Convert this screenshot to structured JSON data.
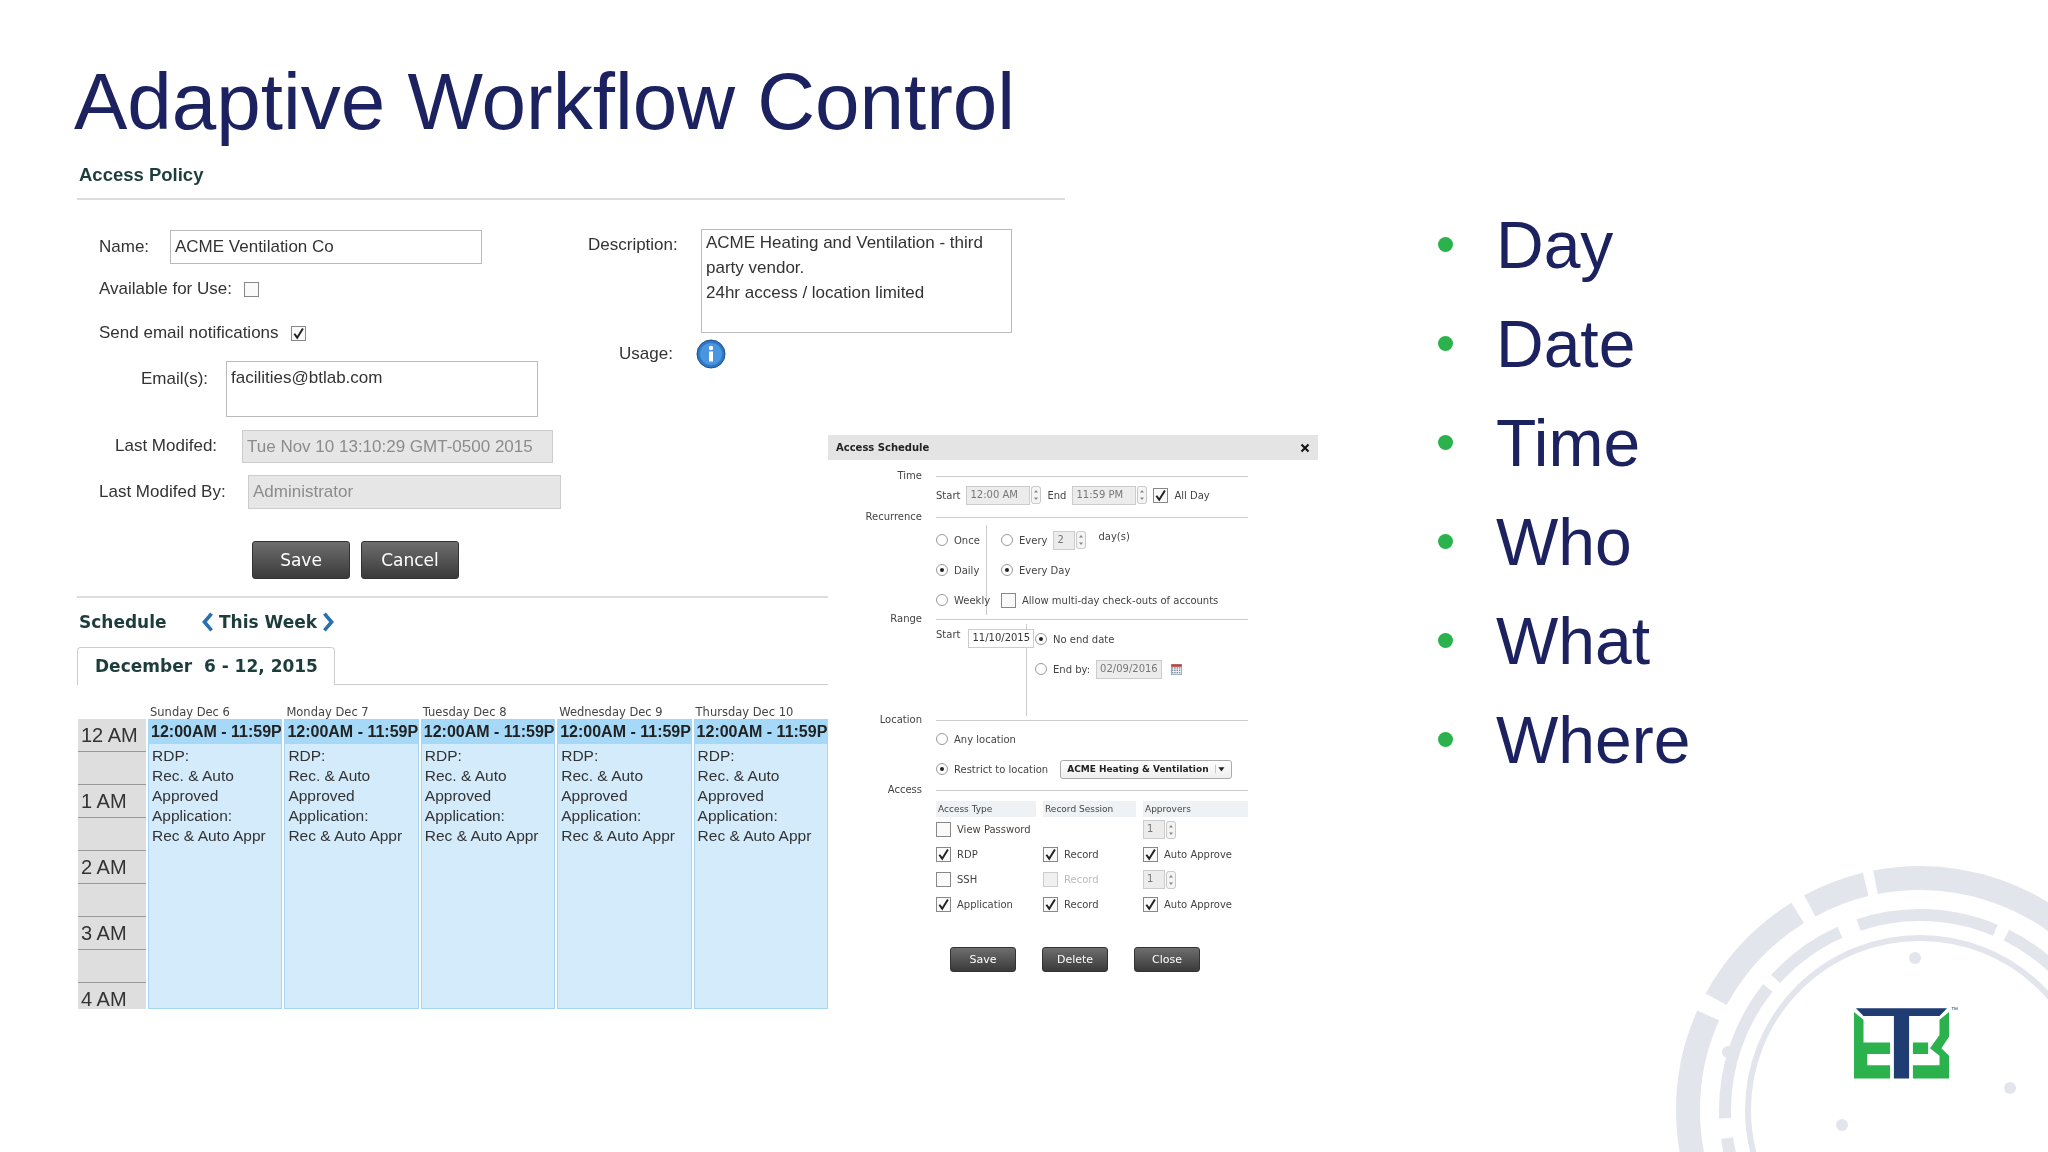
{
  "slide": {
    "title": "Adaptive Workflow Control",
    "bullets": [
      "Day",
      "Date",
      "Time",
      "Who",
      "What",
      "Where"
    ],
    "logo_mark": "™"
  },
  "access_policy": {
    "heading": "Access Policy",
    "name": {
      "label": "Name:",
      "value": "ACME Ventilation Co"
    },
    "available": {
      "label": "Available for Use:",
      "checked": false
    },
    "notifications": {
      "label": "Send email notifications",
      "checked": true
    },
    "emails": {
      "label": "Email(s):",
      "value": "facilities@btlab.com"
    },
    "last_modified": {
      "label": "Last Modifed:",
      "value": "Tue Nov 10 13:10:29 GMT-0500 2015",
      "disabled": true
    },
    "last_modified_by": {
      "label": "Last Modifed By:",
      "value": "Administrator",
      "disabled": true
    },
    "description": {
      "label": "Description:",
      "value": "ACME Heating and Ventilation - third party vendor.\n24hr access / location limited"
    },
    "usage": {
      "label": "Usage:"
    },
    "buttons": [
      "Save",
      "Cancel"
    ]
  },
  "schedule": {
    "heading": "Schedule",
    "nav_label": "This Week",
    "tab": "December  6 - 12, 2015",
    "hours": [
      "12 AM",
      "1 AM",
      "2 AM",
      "3 AM",
      "4 AM"
    ],
    "days": [
      {
        "header": "Sunday Dec 6",
        "event_time": "12:00AM - 11:59P",
        "event_text": "RDP:\nRec. & Auto\nApproved\nApplication:\nRec & Auto Appr"
      },
      {
        "header": "Monday Dec 7",
        "event_time": "12:00AM - 11:59P",
        "event_text": "RDP:\nRec. & Auto\nApproved\nApplication:\nRec & Auto Appr"
      },
      {
        "header": "Tuesday Dec 8",
        "event_time": "12:00AM - 11:59P",
        "event_text": "RDP:\nRec. & Auto\nApproved\nApplication:\nRec & Auto Appr"
      },
      {
        "header": "Wednesday Dec 9",
        "event_time": "12:00AM - 11:59P",
        "event_text": "RDP:\nRec. & Auto\nApproved\nApplication:\nRec & Auto Appr"
      },
      {
        "header": "Thursday Dec 10",
        "event_time": "12:00AM - 11:59P",
        "event_text": "RDP:\nRec. & Auto\nApproved\nApplication:\nRec & Auto Appr"
      }
    ]
  },
  "dialog": {
    "title": "Access Schedule",
    "time": {
      "label": "Time",
      "start_label": "Start",
      "start": "12:00 AM",
      "end_label": "End",
      "end": "11:59 PM",
      "all_day": {
        "label": "All Day",
        "checked": true
      }
    },
    "recurrence": {
      "label": "Recurrence",
      "options": [
        {
          "label": "Once",
          "selected": false
        },
        {
          "label": "Daily",
          "selected": true
        },
        {
          "label": "Weekly",
          "selected": false
        }
      ],
      "daily_options": [
        {
          "kind": "every",
          "label": "Every",
          "value": "2",
          "unit": "day(s)",
          "selected": false
        },
        {
          "kind": "radio",
          "label": "Every Day",
          "selected": true
        },
        {
          "kind": "checkbox",
          "label": "Allow multi-day check-outs of accounts",
          "checked": false
        }
      ]
    },
    "range": {
      "label": "Range",
      "start_label": "Start",
      "start": "11/10/2015",
      "end_options": [
        {
          "label": "No end date",
          "selected": true
        },
        {
          "label": "End by:",
          "selected": false,
          "value": "02/09/2016"
        }
      ]
    },
    "location": {
      "label": "Location",
      "options": [
        {
          "label": "Any location",
          "selected": false
        },
        {
          "label": "Restrict to location",
          "selected": true,
          "value": "ACME Heating & Ventilation"
        }
      ]
    },
    "access": {
      "label": "Access",
      "columns": [
        "Access Type",
        "Record Session",
        "Approvers"
      ],
      "rows": [
        {
          "label": "View Password",
          "checked": false,
          "approvers": {
            "kind": "spinner",
            "value": "1"
          }
        },
        {
          "label": "RDP",
          "checked": true,
          "record": {
            "label": "Record",
            "checked": true,
            "disabled": false
          },
          "approvers": {
            "kind": "auto",
            "label": "Auto Approve",
            "checked": true
          }
        },
        {
          "label": "SSH",
          "checked": false,
          "record": {
            "label": "Record",
            "checked": false,
            "disabled": true
          },
          "approvers": {
            "kind": "spinner",
            "value": "1"
          }
        },
        {
          "label": "Application",
          "checked": true,
          "record": {
            "label": "Record",
            "checked": true,
            "disabled": false
          },
          "approvers": {
            "kind": "auto",
            "label": "Auto Approve",
            "checked": true
          }
        }
      ]
    },
    "buttons": [
      "Save",
      "Delete",
      "Close"
    ]
  }
}
